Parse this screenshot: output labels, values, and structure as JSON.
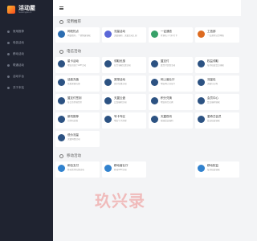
{
  "app": {
    "title": "活动屋",
    "subtitle": "huodongwu.cn"
  },
  "sidebar": {
    "items": [
      {
        "label": "常用推荐"
      },
      {
        "label": "电信活动"
      },
      {
        "label": "移动活动"
      },
      {
        "label": "联通活动"
      },
      {
        "label": "活动平台"
      },
      {
        "label": "关于本站"
      }
    ]
  },
  "sections": {
    "recommend": {
      "title": "常用推荐",
      "cards": [
        {
          "title": "网校热点",
          "desc": "网络推荐，一键快速领取",
          "color": "#2b6cb0"
        },
        {
          "title": "流量活动",
          "desc": "流量福利、流量活动汇总",
          "color": "#5a67d8"
        },
        {
          "title": "一证通查",
          "desc": "查询名下号码号卡",
          "color": "#38a169"
        },
        {
          "title": "工信部",
          "desc": "一证通查官方网站",
          "color": "#dd6b20"
        }
      ]
    },
    "telecom": {
      "title": "电信活动",
      "cards": [
        {
          "title": "星卡活动",
          "desc": "电信营业厅APP活动",
          "color": "#2c5282"
        },
        {
          "title": "领取优惠",
          "desc": "官方领取优惠活动",
          "color": "#2c5282"
        },
        {
          "title": "翼支付",
          "desc": "翼支付优惠活动",
          "color": "#2c5282"
        },
        {
          "title": "权益领取",
          "desc": "每月权益会员领取",
          "color": "#2c5282"
        },
        {
          "title": "话费充值",
          "desc": "话费充值优惠",
          "color": "#2c5282"
        },
        {
          "title": "宽带活动",
          "desc": "宽带优惠活动",
          "color": "#2c5282"
        },
        {
          "title": "网上营业厅",
          "desc": "电信网上营业厅",
          "color": "#2c5282"
        },
        {
          "title": "流量包",
          "desc": "流量包订购",
          "color": "#2c5282"
        },
        {
          "title": "翼支付签到",
          "desc": "每日签到领金币",
          "color": "#2c5282"
        },
        {
          "title": "天翼云盘",
          "desc": "云盘福利活动",
          "color": "#2c5282"
        },
        {
          "title": "积分兑换",
          "desc": "电信积分兑换",
          "color": "#2c5282"
        },
        {
          "title": "会员中心",
          "desc": "会员福利领取",
          "color": "#2c5282"
        },
        {
          "title": "新机推荐",
          "desc": "合约机优惠",
          "color": "#2c5282"
        },
        {
          "title": "号卡专区",
          "desc": "电信号卡办理",
          "color": "#2c5282"
        },
        {
          "title": "天翼视讯",
          "desc": "视频会员福利",
          "color": "#2c5282"
        },
        {
          "title": "爱奇艺会员",
          "desc": "会员权益领取",
          "color": "#2c5282"
        },
        {
          "title": "低价流量",
          "desc": "流量特惠活动",
          "color": "#2c5282"
        }
      ]
    },
    "mobile": {
      "title": "移动活动",
      "cards": [
        {
          "title": "和包支付",
          "desc": "移动支付优惠活动",
          "color": "#3182ce"
        },
        {
          "title": "移动营业厅",
          "desc": "移动APP活动",
          "color": "#3182ce"
        },
        {
          "title": "",
          "desc": "",
          "color": "#ffffff"
        },
        {
          "title": "移动权益",
          "desc": "每月权益领取",
          "color": "#3182ce"
        }
      ]
    }
  },
  "watermark": "玖兴录"
}
